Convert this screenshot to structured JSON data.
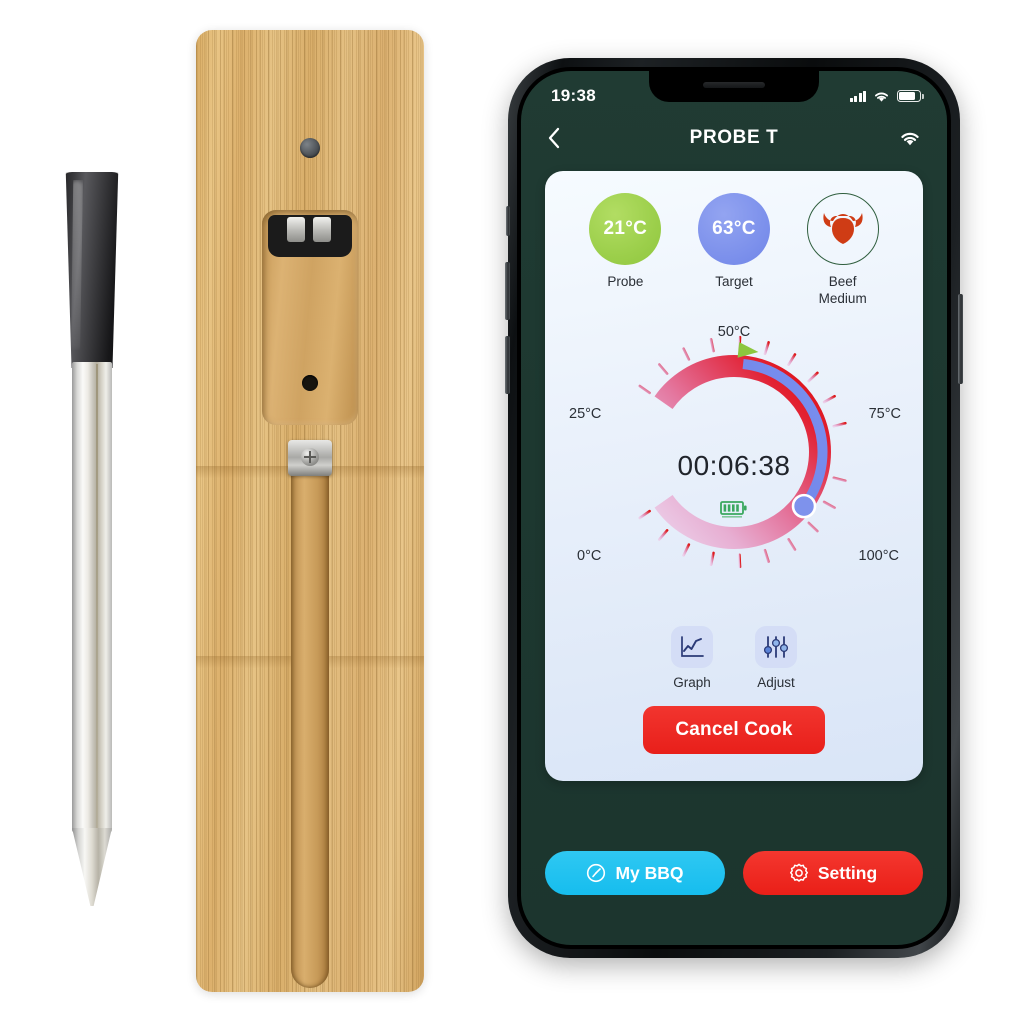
{
  "scene": {
    "probe_device": {
      "name": "wireless-meat-probe",
      "cap_color": "#1b1b1d",
      "shaft_color": "#e3e1da"
    },
    "bamboo_dock": {
      "name": "bamboo-charging-dock",
      "wood_color": "#ddb271"
    }
  },
  "phone": {
    "status_bar": {
      "time": "19:38",
      "signal_icon": "signal-bars-icon",
      "wifi_icon": "wifi-icon",
      "battery_icon": "battery-icon"
    },
    "nav_bar": {
      "back_icon": "chevron-left-icon",
      "title": "PROBE T",
      "wifi_icon": "wifi-icon"
    },
    "app_background": "#1d3830"
  },
  "card": {
    "stats": [
      {
        "value": "21°C",
        "label": "Probe",
        "color": "#9ccf4b",
        "icon": ""
      },
      {
        "value": "63°C",
        "label": "Target",
        "color": "#7e92ec",
        "icon": ""
      },
      {
        "value": "",
        "label": "Beef\nMedium",
        "color": "#2f5e3e",
        "icon": "bull-head-icon"
      }
    ],
    "stat_meat": {
      "line1": "Beef",
      "line2": "Medium"
    },
    "timer": "00:06:38",
    "battery_badge_icon": "battery-charge-icon",
    "actions": [
      {
        "label": "Graph",
        "icon": "line-chart-icon"
      },
      {
        "label": "Adjust",
        "icon": "sliders-icon"
      }
    ],
    "cancel_label": "Cancel Cook"
  },
  "bottom_bar": {
    "my_bbq": {
      "label": "My BBQ",
      "icon": "gauge-icon",
      "color": "#16bdee"
    },
    "setting": {
      "label": "Setting",
      "icon": "gear-icon",
      "color": "#ea1f18"
    }
  },
  "chart_data": {
    "type": "gauge",
    "title": "Cook temperature gauge",
    "unit": "°C",
    "min": 0,
    "max": 100,
    "tick_labels": [
      "0°C",
      "25°C",
      "50°C",
      "75°C",
      "100°C"
    ],
    "tick_values": [
      0,
      25,
      50,
      75,
      100
    ],
    "minor_tick_count": 21,
    "start_angle_deg": 215,
    "sweep_deg": 290,
    "series": [
      {
        "name": "Probe temperature",
        "value": 21,
        "marker": "green-triangle",
        "color": "#8cc63e"
      },
      {
        "name": "Target temperature",
        "value": 63,
        "marker": "blue-dot",
        "color": "#7e92ec"
      }
    ],
    "arc_gradient": [
      "#e9c9e8",
      "#e8a9cf",
      "#e4719f",
      "#e33f55",
      "#e01010"
    ],
    "elapsed_timer": "00:06:38",
    "legend_position": "none",
    "grid": false
  }
}
